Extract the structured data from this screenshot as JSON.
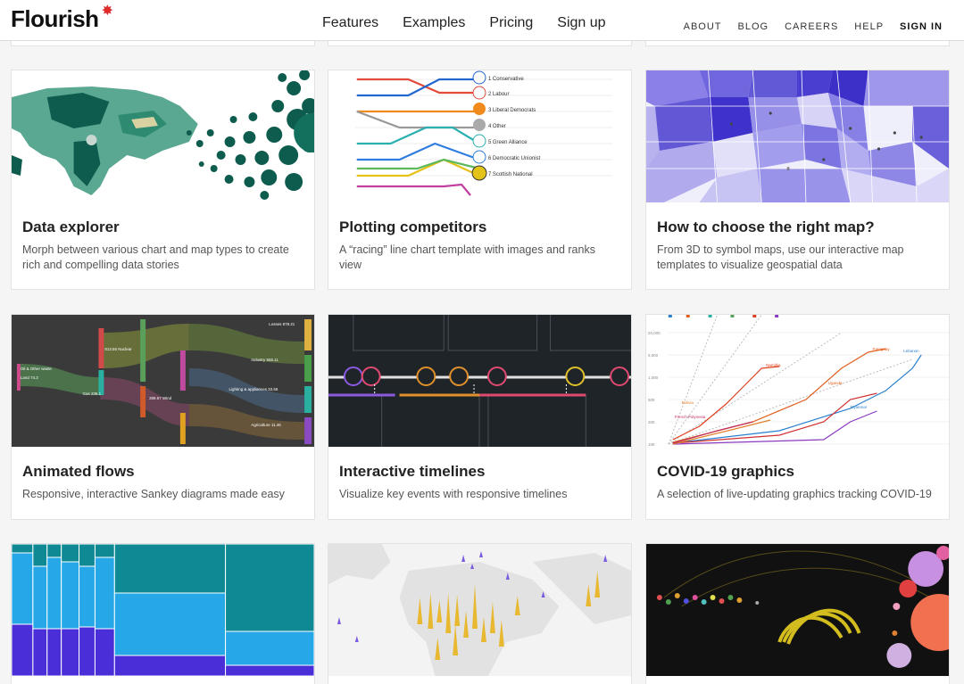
{
  "header": {
    "logo": "Flourish",
    "main_nav": [
      "Features",
      "Examples",
      "Pricing",
      "Sign up"
    ],
    "top_nav": [
      "ABOUT",
      "BLOG",
      "CAREERS",
      "HELP",
      "SIGN IN"
    ]
  },
  "cards": [
    {
      "title": "Data explorer",
      "desc": "Morph between various chart and map types to create rich and compelling data stories"
    },
    {
      "title": "Plotting competitors",
      "desc": "A “racing” line chart template with images and ranks view",
      "thumb_labels": [
        "1 Conservative",
        "2 Labour",
        "3 Liberal Democrats",
        "4 Other",
        "5 Green Alliance",
        "6 Democratic Unionist",
        "7 Scottish National"
      ]
    },
    {
      "title": "How to choose the right map?",
      "desc": "From 3D to symbol maps, use our interactive map templates to visualize geospatial data"
    },
    {
      "title": "Animated flows",
      "desc": "Responsive, interactive Sankey diagrams made easy"
    },
    {
      "title": "Interactive timelines",
      "desc": "Visualize key events with responsive timelines"
    },
    {
      "title": "COVID-19 graphics",
      "desc": "A selection of live-updating graphics tracking COVID-19",
      "thumb_labels": [
        "Namibia",
        "Paraguay",
        "Lebanon",
        "Uganda",
        "Myanmar",
        "Bolivia",
        "French Polynesia"
      ]
    },
    {
      "title": "",
      "desc": ""
    },
    {
      "title": "",
      "desc": ""
    },
    {
      "title": "",
      "desc": ""
    }
  ],
  "colors": {
    "accent": "#e02b2b",
    "teal": "#0d5c4e",
    "purple": "#7a6fe0",
    "dark": "#1f2429"
  }
}
